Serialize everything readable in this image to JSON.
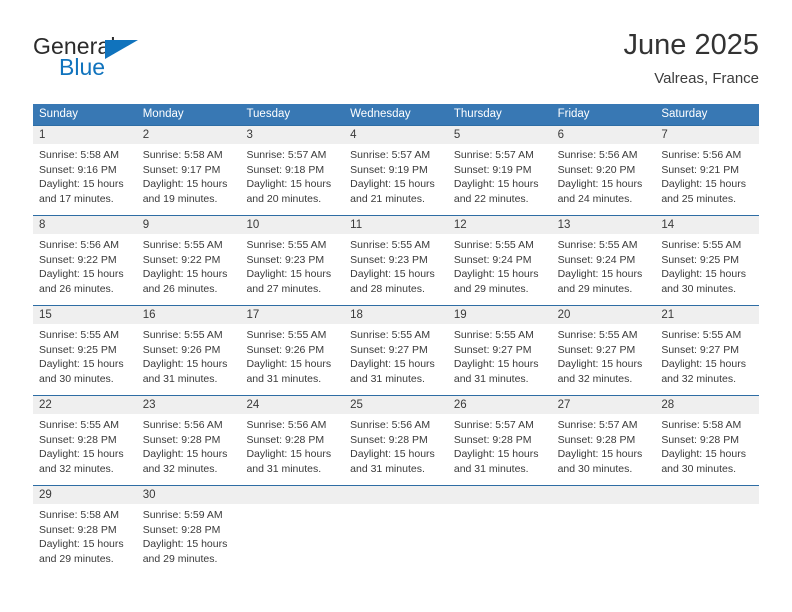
{
  "brand": {
    "name_part1": "General",
    "name_part2": "Blue",
    "triangle_color": "#1073bd"
  },
  "header": {
    "title": "June 2025",
    "subtitle": "Valreas, France"
  },
  "theme": {
    "header_blue": "#3878b4",
    "separator_blue": "#2e6da4",
    "daynum_band": "#efefef",
    "text": "#3a3a3a"
  },
  "weekdays": [
    "Sunday",
    "Monday",
    "Tuesday",
    "Wednesday",
    "Thursday",
    "Friday",
    "Saturday"
  ],
  "weeks": [
    {
      "days": [
        {
          "num": "1",
          "sunrise": "Sunrise: 5:58 AM",
          "sunset": "Sunset: 9:16 PM",
          "daylight1": "Daylight: 15 hours",
          "daylight2": "and 17 minutes."
        },
        {
          "num": "2",
          "sunrise": "Sunrise: 5:58 AM",
          "sunset": "Sunset: 9:17 PM",
          "daylight1": "Daylight: 15 hours",
          "daylight2": "and 19 minutes."
        },
        {
          "num": "3",
          "sunrise": "Sunrise: 5:57 AM",
          "sunset": "Sunset: 9:18 PM",
          "daylight1": "Daylight: 15 hours",
          "daylight2": "and 20 minutes."
        },
        {
          "num": "4",
          "sunrise": "Sunrise: 5:57 AM",
          "sunset": "Sunset: 9:19 PM",
          "daylight1": "Daylight: 15 hours",
          "daylight2": "and 21 minutes."
        },
        {
          "num": "5",
          "sunrise": "Sunrise: 5:57 AM",
          "sunset": "Sunset: 9:19 PM",
          "daylight1": "Daylight: 15 hours",
          "daylight2": "and 22 minutes."
        },
        {
          "num": "6",
          "sunrise": "Sunrise: 5:56 AM",
          "sunset": "Sunset: 9:20 PM",
          "daylight1": "Daylight: 15 hours",
          "daylight2": "and 24 minutes."
        },
        {
          "num": "7",
          "sunrise": "Sunrise: 5:56 AM",
          "sunset": "Sunset: 9:21 PM",
          "daylight1": "Daylight: 15 hours",
          "daylight2": "and 25 minutes."
        }
      ]
    },
    {
      "days": [
        {
          "num": "8",
          "sunrise": "Sunrise: 5:56 AM",
          "sunset": "Sunset: 9:22 PM",
          "daylight1": "Daylight: 15 hours",
          "daylight2": "and 26 minutes."
        },
        {
          "num": "9",
          "sunrise": "Sunrise: 5:55 AM",
          "sunset": "Sunset: 9:22 PM",
          "daylight1": "Daylight: 15 hours",
          "daylight2": "and 26 minutes."
        },
        {
          "num": "10",
          "sunrise": "Sunrise: 5:55 AM",
          "sunset": "Sunset: 9:23 PM",
          "daylight1": "Daylight: 15 hours",
          "daylight2": "and 27 minutes."
        },
        {
          "num": "11",
          "sunrise": "Sunrise: 5:55 AM",
          "sunset": "Sunset: 9:23 PM",
          "daylight1": "Daylight: 15 hours",
          "daylight2": "and 28 minutes."
        },
        {
          "num": "12",
          "sunrise": "Sunrise: 5:55 AM",
          "sunset": "Sunset: 9:24 PM",
          "daylight1": "Daylight: 15 hours",
          "daylight2": "and 29 minutes."
        },
        {
          "num": "13",
          "sunrise": "Sunrise: 5:55 AM",
          "sunset": "Sunset: 9:24 PM",
          "daylight1": "Daylight: 15 hours",
          "daylight2": "and 29 minutes."
        },
        {
          "num": "14",
          "sunrise": "Sunrise: 5:55 AM",
          "sunset": "Sunset: 9:25 PM",
          "daylight1": "Daylight: 15 hours",
          "daylight2": "and 30 minutes."
        }
      ]
    },
    {
      "days": [
        {
          "num": "15",
          "sunrise": "Sunrise: 5:55 AM",
          "sunset": "Sunset: 9:25 PM",
          "daylight1": "Daylight: 15 hours",
          "daylight2": "and 30 minutes."
        },
        {
          "num": "16",
          "sunrise": "Sunrise: 5:55 AM",
          "sunset": "Sunset: 9:26 PM",
          "daylight1": "Daylight: 15 hours",
          "daylight2": "and 31 minutes."
        },
        {
          "num": "17",
          "sunrise": "Sunrise: 5:55 AM",
          "sunset": "Sunset: 9:26 PM",
          "daylight1": "Daylight: 15 hours",
          "daylight2": "and 31 minutes."
        },
        {
          "num": "18",
          "sunrise": "Sunrise: 5:55 AM",
          "sunset": "Sunset: 9:27 PM",
          "daylight1": "Daylight: 15 hours",
          "daylight2": "and 31 minutes."
        },
        {
          "num": "19",
          "sunrise": "Sunrise: 5:55 AM",
          "sunset": "Sunset: 9:27 PM",
          "daylight1": "Daylight: 15 hours",
          "daylight2": "and 31 minutes."
        },
        {
          "num": "20",
          "sunrise": "Sunrise: 5:55 AM",
          "sunset": "Sunset: 9:27 PM",
          "daylight1": "Daylight: 15 hours",
          "daylight2": "and 32 minutes."
        },
        {
          "num": "21",
          "sunrise": "Sunrise: 5:55 AM",
          "sunset": "Sunset: 9:27 PM",
          "daylight1": "Daylight: 15 hours",
          "daylight2": "and 32 minutes."
        }
      ]
    },
    {
      "days": [
        {
          "num": "22",
          "sunrise": "Sunrise: 5:55 AM",
          "sunset": "Sunset: 9:28 PM",
          "daylight1": "Daylight: 15 hours",
          "daylight2": "and 32 minutes."
        },
        {
          "num": "23",
          "sunrise": "Sunrise: 5:56 AM",
          "sunset": "Sunset: 9:28 PM",
          "daylight1": "Daylight: 15 hours",
          "daylight2": "and 32 minutes."
        },
        {
          "num": "24",
          "sunrise": "Sunrise: 5:56 AM",
          "sunset": "Sunset: 9:28 PM",
          "daylight1": "Daylight: 15 hours",
          "daylight2": "and 31 minutes."
        },
        {
          "num": "25",
          "sunrise": "Sunrise: 5:56 AM",
          "sunset": "Sunset: 9:28 PM",
          "daylight1": "Daylight: 15 hours",
          "daylight2": "and 31 minutes."
        },
        {
          "num": "26",
          "sunrise": "Sunrise: 5:57 AM",
          "sunset": "Sunset: 9:28 PM",
          "daylight1": "Daylight: 15 hours",
          "daylight2": "and 31 minutes."
        },
        {
          "num": "27",
          "sunrise": "Sunrise: 5:57 AM",
          "sunset": "Sunset: 9:28 PM",
          "daylight1": "Daylight: 15 hours",
          "daylight2": "and 30 minutes."
        },
        {
          "num": "28",
          "sunrise": "Sunrise: 5:58 AM",
          "sunset": "Sunset: 9:28 PM",
          "daylight1": "Daylight: 15 hours",
          "daylight2": "and 30 minutes."
        }
      ]
    },
    {
      "days": [
        {
          "num": "29",
          "sunrise": "Sunrise: 5:58 AM",
          "sunset": "Sunset: 9:28 PM",
          "daylight1": "Daylight: 15 hours",
          "daylight2": "and 29 minutes."
        },
        {
          "num": "30",
          "sunrise": "Sunrise: 5:59 AM",
          "sunset": "Sunset: 9:28 PM",
          "daylight1": "Daylight: 15 hours",
          "daylight2": "and 29 minutes."
        },
        {
          "num": "",
          "sunrise": "",
          "sunset": "",
          "daylight1": "",
          "daylight2": ""
        },
        {
          "num": "",
          "sunrise": "",
          "sunset": "",
          "daylight1": "",
          "daylight2": ""
        },
        {
          "num": "",
          "sunrise": "",
          "sunset": "",
          "daylight1": "",
          "daylight2": ""
        },
        {
          "num": "",
          "sunrise": "",
          "sunset": "",
          "daylight1": "",
          "daylight2": ""
        },
        {
          "num": "",
          "sunrise": "",
          "sunset": "",
          "daylight1": "",
          "daylight2": ""
        }
      ]
    }
  ]
}
